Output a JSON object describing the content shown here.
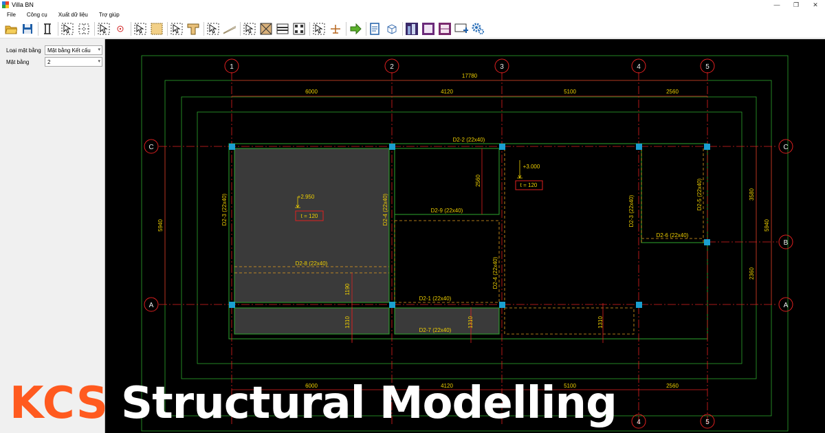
{
  "window": {
    "title": "Villa BN",
    "min": "—",
    "restore": "❐",
    "close": "✕"
  },
  "menu": [
    "File",
    "Công cụ",
    "Xuất dữ liệu",
    "Trợ giúp"
  ],
  "toolbar": {
    "icons": [
      "open-folder-icon",
      "save-icon",
      "column-icon",
      "select-beam-icon",
      "grid-dots-icon",
      "select-point-icon",
      "target-icon",
      "select-slab-icon",
      "slab-icon",
      "select-column-icon",
      "column-t-icon",
      "select-wall-icon",
      "stair-icon",
      "select-area-icon",
      "opening-icon",
      "beam-section-icon",
      "grid-select-icon",
      "select-load-icon",
      "load-icon",
      "export-arrow-icon",
      "report-icon",
      "3d-view-icon",
      "building-icon",
      "frame-view-icon",
      "frame-view-2-icon",
      "monitor-icon",
      "settings-icon"
    ]
  },
  "panel": {
    "floor_type_label": "Loại mặt bằng",
    "floor_type_value": "Mặt bằng Kết cấu",
    "floor_label": "Mặt bằng",
    "floor_value": "2"
  },
  "drawing": {
    "grid_cols": [
      "1",
      "2",
      "3",
      "4",
      "5"
    ],
    "grid_rows": [
      "C",
      "B",
      "A"
    ],
    "total_width": "17780",
    "spans": [
      "6000",
      "4120",
      "5100",
      "2560"
    ],
    "left_height": "5940",
    "right_height": "5940",
    "right_seg_1": "3580",
    "right_seg_2": "2360",
    "beams": {
      "d2_2": "D2-2 (22x40)",
      "d2_9": "D2-9 (22x40)",
      "d2_8": "D2-8 (22x40)",
      "d2_1": "D2-1 (22x40)",
      "d2_7": "D2-7 (22x40)",
      "d2_6": "D2-6 (22x40)",
      "d2_3_left": "D2-3 (22x40)",
      "d2_4_left": "D2-4 (22x40)",
      "d2_4_mid": "D2-4 (22x40)",
      "d2_3_right": "D2-3 (22x40)",
      "d2_5": "D2-5 (22x40)"
    },
    "dims": {
      "d2560": "2560",
      "d1190": "1190",
      "d1310_a": "1310",
      "d1310_b": "1310",
      "d1310_c": "1310"
    },
    "levels": {
      "slab1": "+2.950",
      "slab2": "+3.000"
    },
    "thickness": {
      "slab1": "t = 120",
      "slab2": "t = 120"
    }
  },
  "brand": {
    "name": "KCS",
    "tagline": "Structural Modelling"
  },
  "colors": {
    "canvas": "#000000",
    "grid_line": "#e02020",
    "outline": "#2ea82e",
    "text": "#f0d000",
    "slab_fill": "#3a3a3a",
    "column": "#1a9fd0",
    "brand": "#ff5a1f"
  }
}
